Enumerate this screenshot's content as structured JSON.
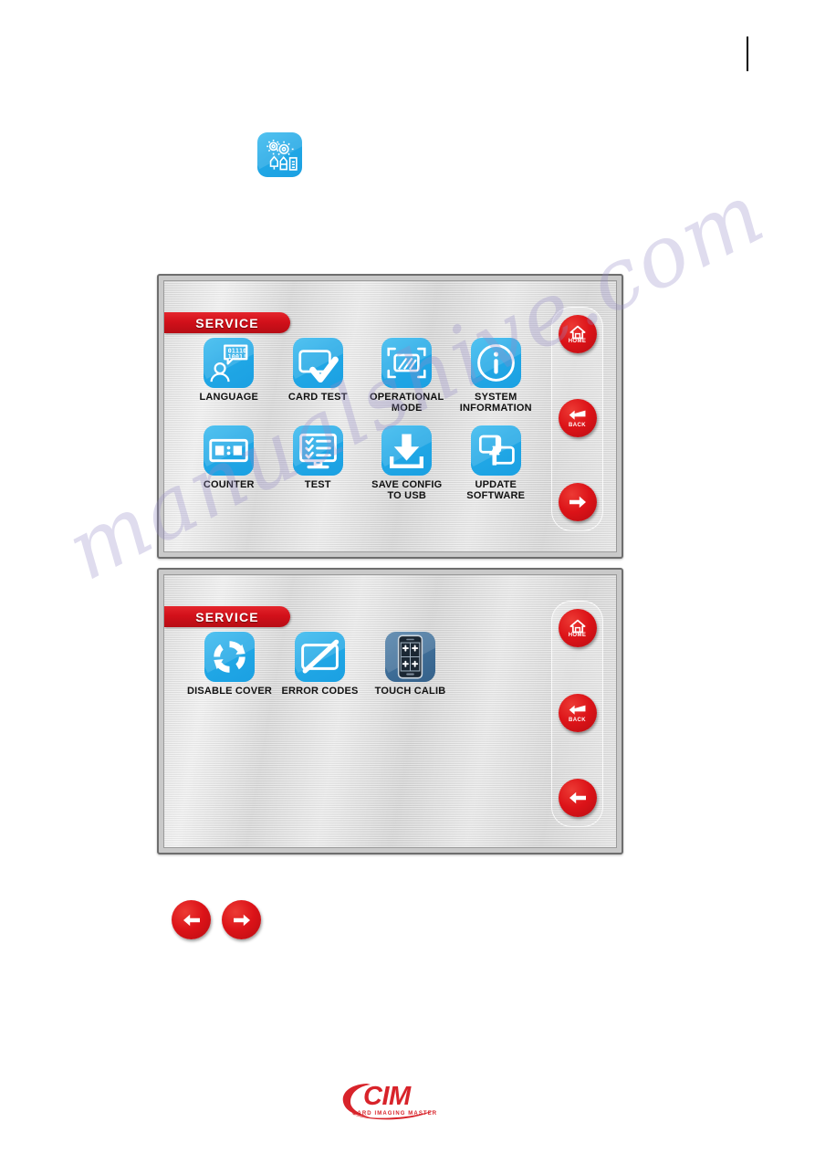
{
  "page": {
    "top_rule": "vertical-rule"
  },
  "settings_icon": {
    "name": "service-settings-icon",
    "glyph": "gears-pen-tools-icon",
    "color": "#21a8e6"
  },
  "watermark": {
    "text": "manualshive.com"
  },
  "colors": {
    "accent_red": "#d2101a",
    "tile_blue": "#21a8e6",
    "tile_dark_blue": "#3f6e98",
    "panel_grey": "#d8d8d8"
  },
  "screens": [
    {
      "id": "service-screen-page-1",
      "banner": "SERVICE",
      "rows": [
        [
          {
            "label": "LANGUAGE",
            "icon": "language-person-binary-icon",
            "dark": false
          },
          {
            "label": "CARD TEST",
            "icon": "card-checkmark-icon",
            "dark": false
          },
          {
            "label": "OPERATIONAL\nMODE",
            "icon": "operational-mode-card-scan-icon",
            "dark": false
          },
          {
            "label": "SYSTEM\nINFORMATION",
            "icon": "info-circle-icon",
            "dark": false
          }
        ],
        [
          {
            "label": "COUNTER",
            "icon": "counter-display-icon",
            "dark": false
          },
          {
            "label": "TEST",
            "icon": "test-monitor-checklist-icon",
            "dark": false
          },
          {
            "label": "SAVE CONFIG\nTO USB",
            "icon": "download-save-icon",
            "dark": false
          },
          {
            "label": "UPDATE\nSOFTWARE",
            "icon": "update-software-transfer-icon",
            "dark": false
          }
        ]
      ],
      "nav": [
        {
          "label": "HOME",
          "icon": "home-icon",
          "name": "home-button"
        },
        {
          "label": "BACK",
          "icon": "enter-return-arrow-icon",
          "name": "back-button"
        },
        {
          "label": "",
          "icon": "arrow-right-icon",
          "name": "next-page-button"
        }
      ]
    },
    {
      "id": "service-screen-page-2",
      "banner": "SERVICE",
      "rows": [
        [
          {
            "label": "DISABLE COVER",
            "icon": "refresh-cycle-icon",
            "dark": false
          },
          {
            "label": "ERROR CODES",
            "icon": "card-slash-pen-icon",
            "dark": false
          },
          {
            "label": "TOUCH CALIB",
            "icon": "touch-calibration-phone-icon",
            "dark": true
          }
        ]
      ],
      "nav": [
        {
          "label": "HOME",
          "icon": "home-icon",
          "name": "home-button"
        },
        {
          "label": "BACK",
          "icon": "enter-return-arrow-icon",
          "name": "back-button"
        },
        {
          "label": "",
          "icon": "arrow-left-icon",
          "name": "previous-page-button"
        }
      ]
    }
  ],
  "bottom_arrows": [
    {
      "icon": "arrow-left-icon",
      "name": "previous-arrow-legend"
    },
    {
      "icon": "arrow-right-icon",
      "name": "next-arrow-legend"
    }
  ],
  "footer": {
    "logo_word": "CIM",
    "logo_tagline": "CARD IMAGING MASTER"
  }
}
